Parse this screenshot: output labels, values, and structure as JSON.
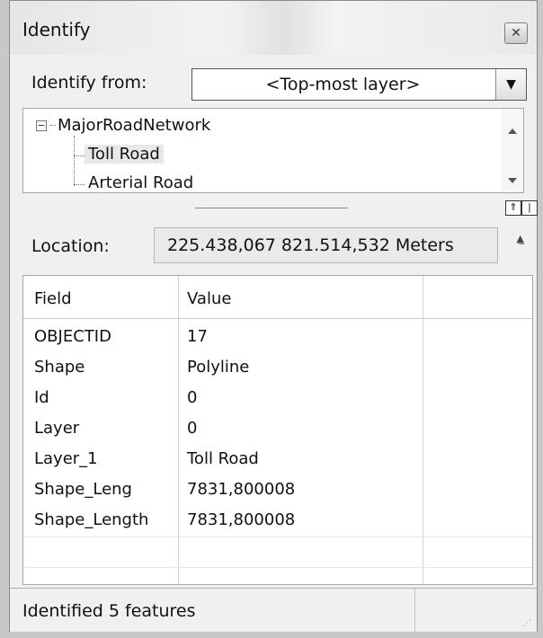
{
  "window": {
    "title": "Identify"
  },
  "identify_from": {
    "label": "Identify from:",
    "value": "<Top-most layer>"
  },
  "tree": {
    "root": "MajorRoadNetwork",
    "children": [
      "Toll Road",
      "Arterial Road"
    ],
    "selected": "Toll Road"
  },
  "location": {
    "label": "Location:",
    "value": "225.438,067  821.514,532 Meters"
  },
  "grid": {
    "headers": [
      "Field",
      "Value"
    ],
    "rows": [
      {
        "field": "OBJECTID",
        "value": "17"
      },
      {
        "field": "Shape",
        "value": "Polyline"
      },
      {
        "field": "Id",
        "value": "0"
      },
      {
        "field": "Layer",
        "value": "0"
      },
      {
        "field": "Layer_1",
        "value": "Toll Road"
      },
      {
        "field": "Shape_Leng",
        "value": "7831,800008"
      },
      {
        "field": "Shape_Length",
        "value": "7831,800008"
      }
    ]
  },
  "status": {
    "text": "Identified 5 features"
  },
  "icons": {
    "close": "close-icon",
    "dropdown": "chevron-down-icon",
    "collapse": "collapse-panel-icon",
    "layout": "layout-toggle-icon"
  }
}
